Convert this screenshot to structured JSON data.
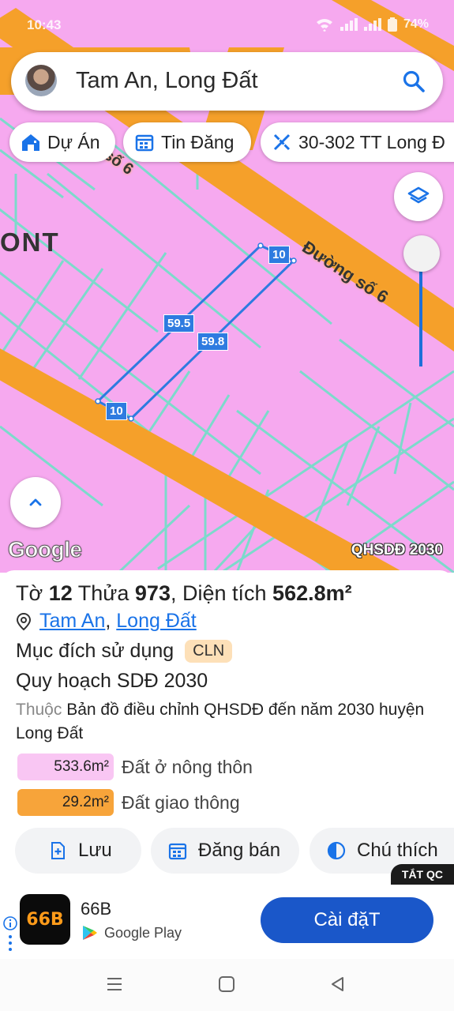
{
  "status_bar": {
    "time": "10:43",
    "battery": "74%"
  },
  "search": {
    "query": "Tam An, Long Đất"
  },
  "chips": [
    {
      "label": "Dự Án",
      "icon": "house-icon"
    },
    {
      "label": "Tin Đăng",
      "icon": "calendar-icon"
    },
    {
      "label": "30-302 TT Long Đ",
      "icon": "ruler-icon"
    }
  ],
  "map": {
    "area_text": "ONT",
    "road_label": "Đường số 6",
    "road_label_partial": "số 6",
    "edge_labels": [
      "10",
      "59.5",
      "59.8",
      "10"
    ],
    "attribution": "Google",
    "plan_layer": "QHSDĐ 2030",
    "colors": {
      "residential": "#f6a9ef",
      "road": "#f5a02a",
      "parcel_lines": "#6fe0c8",
      "parcel_outline": "#2e7be0"
    }
  },
  "parcel": {
    "sheet_label": "Tờ",
    "sheet": "12",
    "plot_label": "Thửa",
    "plot": "973",
    "area_label": ", Diện tích",
    "area": "562.8m²",
    "commune": "Tam An",
    "district": "Long Đất",
    "purpose_label": "Mục đích sử dụng",
    "purpose_code": "CLN",
    "plan_title": "Quy hoạch SDĐ 2030",
    "belongs_prefix": "Thuộc",
    "belongs_text": "Bản đồ điều chỉnh QHSDĐ đến năm 2030 huyện Long Đất",
    "zones": [
      {
        "area": "533.6m²",
        "label": "Đất ở nông thôn",
        "color": "#f9c6f3"
      },
      {
        "area": "29.2m²",
        "label": "Đất giao thông",
        "color": "#f7a43a"
      }
    ]
  },
  "actions": [
    {
      "label": "Lưu",
      "icon": "add-bookmark-icon"
    },
    {
      "label": "Đăng bán",
      "icon": "calendar-icon"
    },
    {
      "label": "Chú thích",
      "icon": "contrast-icon"
    }
  ],
  "ad": {
    "close_label": "TẮT QC",
    "logo_text": "66B",
    "name": "66B",
    "store": "Google Play",
    "cta": "Cài đặT"
  }
}
